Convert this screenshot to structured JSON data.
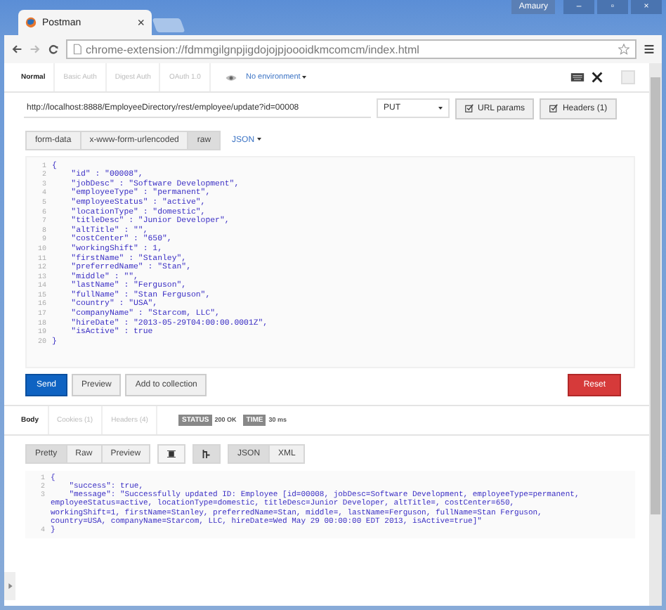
{
  "window": {
    "user": "Amaury",
    "controls": [
      "–",
      "▫",
      "×"
    ]
  },
  "tab": {
    "title": "Postman",
    "close": "×"
  },
  "address_bar": {
    "url": "chrome-extension://fdmmgilgnpjigdojojpjoooidkmcomcm/index.html"
  },
  "auth_tabs": [
    {
      "label": "Normal",
      "selected": true
    },
    {
      "label": "Basic Auth",
      "selected": false
    },
    {
      "label": "Digest Auth",
      "selected": false
    },
    {
      "label": "OAuth 1.0",
      "selected": false
    }
  ],
  "environment": "No environment",
  "request": {
    "url": "http://localhost:8888/EmployeeDirectory/rest/employee/update?id=00008",
    "method": "PUT",
    "url_params": "URL params",
    "headers": "Headers (1)"
  },
  "body_types": [
    {
      "label": "form-data",
      "selected": false
    },
    {
      "label": "x-www-form-urlencoded",
      "selected": false
    },
    {
      "label": "raw",
      "selected": true
    }
  ],
  "body_format": "JSON",
  "editor_lines": [
    {
      "n": "1",
      "text": "{"
    },
    {
      "n": "2",
      "text": "    \"id\" : \"00008\","
    },
    {
      "n": "3",
      "text": "    \"jobDesc\" : \"Software Development\","
    },
    {
      "n": "4",
      "text": "    \"employeeType\" : \"permanent\","
    },
    {
      "n": "5",
      "text": "    \"employeeStatus\" : \"active\","
    },
    {
      "n": "6",
      "text": "    \"locationType\" : \"domestic\","
    },
    {
      "n": "7",
      "text": "    \"titleDesc\" : \"Junior Developer\","
    },
    {
      "n": "8",
      "text": "    \"altTitle\" : \"\","
    },
    {
      "n": "9",
      "text": "    \"costCenter\" : \"650\","
    },
    {
      "n": "10",
      "text": "    \"workingShift\" : 1,"
    },
    {
      "n": "11",
      "text": "    \"firstName\" : \"Stanley\","
    },
    {
      "n": "12",
      "text": "    \"preferredName\" : \"Stan\","
    },
    {
      "n": "13",
      "text": "    \"middle\" : \"\","
    },
    {
      "n": "14",
      "text": "    \"lastName\" : \"Ferguson\","
    },
    {
      "n": "15",
      "text": "    \"fullName\" : \"Stan Ferguson\","
    },
    {
      "n": "16",
      "text": "    \"country\" : \"USA\","
    },
    {
      "n": "17",
      "text": "    \"companyName\" : \"Starcom, LLC\","
    },
    {
      "n": "18",
      "text": "    \"hireDate\" : \"2013-05-29T04:00:00.0001Z\","
    },
    {
      "n": "19",
      "text": "    \"isActive\" : true"
    },
    {
      "n": "20",
      "text": "}"
    }
  ],
  "actions": [
    {
      "label": "Send",
      "kind": "primary"
    },
    {
      "label": "Preview",
      "kind": "default"
    },
    {
      "label": "Add to collection",
      "kind": "default"
    },
    {
      "label": "Reset",
      "kind": "danger"
    }
  ],
  "response_tabs": [
    {
      "label": "Body",
      "selected": true
    },
    {
      "label": "Cookies (1)",
      "selected": false
    },
    {
      "label": "Headers (4)",
      "selected": false
    }
  ],
  "status": {
    "label": "STATUS",
    "value": "200 OK"
  },
  "time": {
    "label": "TIME",
    "value": "30 ms"
  },
  "view_modes": [
    {
      "label": "Pretty",
      "selected": true
    },
    {
      "label": "Raw",
      "selected": false
    },
    {
      "label": "Preview",
      "selected": false
    }
  ],
  "formats": [
    {
      "label": "JSON",
      "selected": true
    },
    {
      "label": "XML",
      "selected": false
    }
  ],
  "response_lines": [
    {
      "n": "1",
      "text": "{"
    },
    {
      "n": "2",
      "text": "    \"success\": true,"
    },
    {
      "n": "3",
      "text": "    \"message\": \"Successfully updated ID: Employee [id=00008, jobDesc=Software Development, employeeType=permanent,"
    },
    {
      "text": "employeeStatus=active, locationType=domestic, titleDesc=Junior Developer, altTitle=, costCenter=650,"
    },
    {
      "text": "workingShift=1, firstName=Stanley, preferredName=Stan, middle=, lastName=Ferguson, fullName=Stan Ferguson,"
    },
    {
      "text": "country=USA, companyName=Starcom, LLC, hireDate=Wed May 29 00:00:00 EDT 2013, isActive=true]\""
    },
    {
      "n": "4",
      "text": "}"
    }
  ]
}
